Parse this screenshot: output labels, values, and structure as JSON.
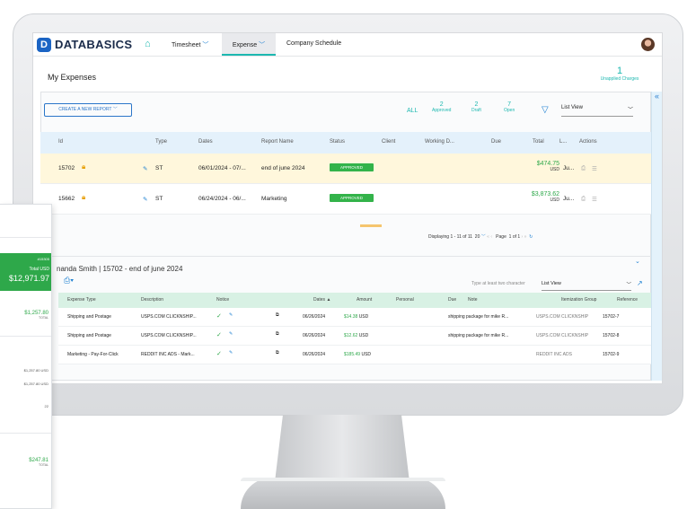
{
  "nav": {
    "brand": "DATABASICS",
    "logo": "D",
    "items": [
      "Timesheet",
      "Expense",
      "Company Schedule"
    ]
  },
  "page": {
    "title": "My Expenses",
    "unapplied_count": "1",
    "unapplied_label": "Unapplied Charges"
  },
  "toolbar": {
    "create_label": "CREATE A NEW REPORT",
    "all": "ALL",
    "counts": [
      {
        "n": "2",
        "label": "Approved"
      },
      {
        "n": "2",
        "label": "Draft"
      },
      {
        "n": "7",
        "label": "Open"
      }
    ],
    "view": "List View"
  },
  "reports": {
    "headers": [
      "Id",
      "Type",
      "Dates",
      "Report Name",
      "Status",
      "Client",
      "Working D...",
      "Due",
      "Total",
      "L...",
      "Actions"
    ],
    "rows": [
      {
        "id": "15702",
        "type": "ST",
        "dates": "06/01/2024 - 07/...",
        "name": "end of june 2024",
        "status": "APPROVED",
        "total": "$474.75",
        "currency": "USD",
        "l": "Ju..."
      },
      {
        "id": "15662",
        "type": "ST",
        "dates": "06/24/2024 - 06/...",
        "name": "Marketing",
        "status": "APPROVED",
        "total": "$3,873.62",
        "currency": "USD",
        "l": "Ju..."
      }
    ],
    "pager": {
      "display": "Displaying 1 - 11 of 11",
      "size": "20",
      "page_label": "Page",
      "page": "1",
      "of": "of 1"
    }
  },
  "detail": {
    "title": "nanda Smith  |  15702 - end of june 2024",
    "search_placeholder": "Type at least two character",
    "view": "List View",
    "headers": [
      "Expense Type",
      "Description",
      "Notice",
      "Dates",
      "Amount",
      "Personal",
      "Due",
      "Note",
      "Itemization Group",
      "Reference"
    ],
    "rows": [
      {
        "type": "Shipping and Postage",
        "desc": "USPS.COM CLICKNSHIP...",
        "date": "06/26/2024",
        "amount": "$14.38",
        "cur": "USD",
        "note": "shipping package for mike R...",
        "group": "USPS.COM CLICKNSHIP",
        "ref": "15702-7"
      },
      {
        "type": "Shipping and Postage",
        "desc": "USPS.COM CLICKNSHIP...",
        "date": "06/26/2024",
        "amount": "$12.62",
        "cur": "USD",
        "note": "shipping package for mike R...",
        "group": "USPS.COM CLICKNSHIP",
        "ref": "15702-8"
      },
      {
        "type": "Marketing - Pay-For-Click",
        "desc": "REDDIT INC ADS - Mark...",
        "date": "06/26/2024",
        "amount": "$185.49",
        "cur": "USD",
        "note": "",
        "group": "REDDIT INC ADS",
        "ref": "15702-9"
      }
    ]
  },
  "card": {
    "id": "#15305",
    "total_label": "Total USD",
    "total": "$12,971.97",
    "amt1": "$1,257.80",
    "amt1_label": "TOTAL",
    "line1": "$1,257.80 USD",
    "line2": "$1,257.80 USD",
    "small": "22",
    "amt2": "$247.81",
    "amt2_label": "TOTAL"
  }
}
